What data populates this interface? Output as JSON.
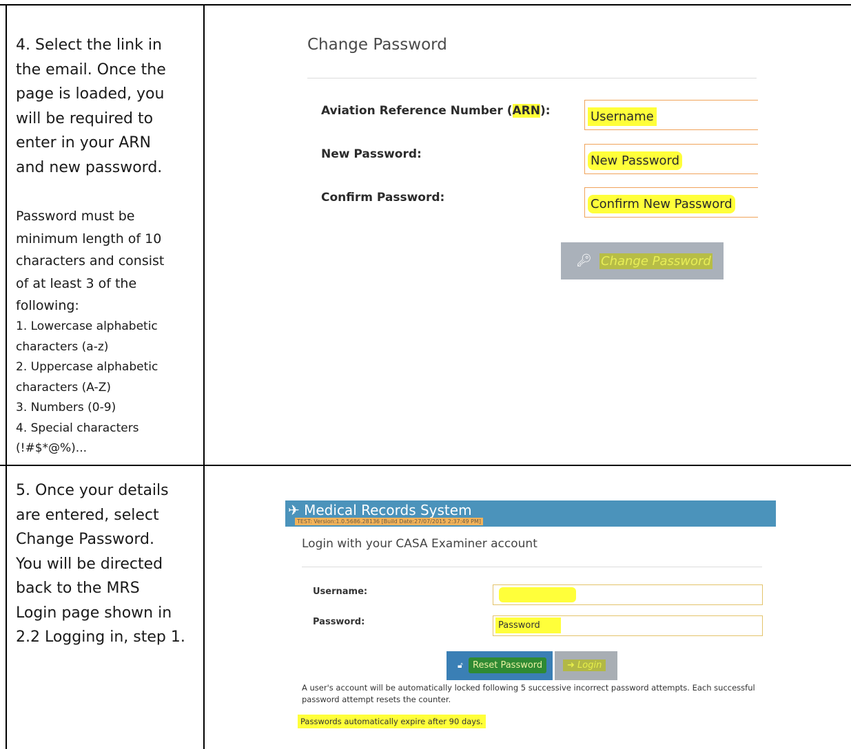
{
  "step4": {
    "lines": [
      "4. Select the link in",
      "the email. Once the",
      "page is loaded, you",
      "will be required to",
      "enter in your ARN",
      "and new password."
    ],
    "rules_intro": [
      "Password must be",
      "minimum length of 10",
      "characters and consist",
      "of at least 3 of the",
      "following:"
    ],
    "rules": [
      "1. Lowercase alphabetic",
      "characters (a-z)",
      "2. Uppercase alphabetic",
      "characters (A-Z)",
      "3. Numbers (0-9)",
      "4. Special characters",
      "(!#$*@%)..."
    ]
  },
  "change_password": {
    "title": "Change Password",
    "arn_label_prefix": "Aviation Reference Number (",
    "arn_label_abbr": "ARN",
    "arn_label_suffix": "):",
    "new_label": "New Password:",
    "confirm_label": "Confirm Password:",
    "username_value": "Username",
    "new_value": "New Password",
    "confirm_value": "Confirm New Password",
    "button_label": "Change Password",
    "button_icon": "key-icon"
  },
  "step5": {
    "lines": [
      "5. Once your details",
      "are entered, select",
      "Change Password.",
      "You will be directed",
      "back to the MRS",
      "Login page shown in",
      "2.2 Logging in, step 1."
    ]
  },
  "mrs": {
    "app_title": "Medical Records System",
    "app_icon": "plane-icon",
    "version": "TEST: Version:1.0.5686.28136 [Build Date:27/07/2015 2:37:49 PM]",
    "subtitle": "Login with your CASA Examiner account",
    "username_label": "Username:",
    "password_label": "Password:",
    "password_value": "Password",
    "reset_button": "Reset Password",
    "login_button": "Login",
    "lock_note": "A user's account will be automatically locked following 5 successive incorrect password attempts. Each successful password attempt resets the counter.",
    "expire_note": "Passwords automatically expire after 90 days."
  },
  "colors": {
    "highlight": "#ffff3a",
    "version_highlight": "#f3b35a",
    "header_blue": "#4b93bb",
    "reset_blue": "#3a7fb5",
    "button_grey": "#aab1ba"
  }
}
